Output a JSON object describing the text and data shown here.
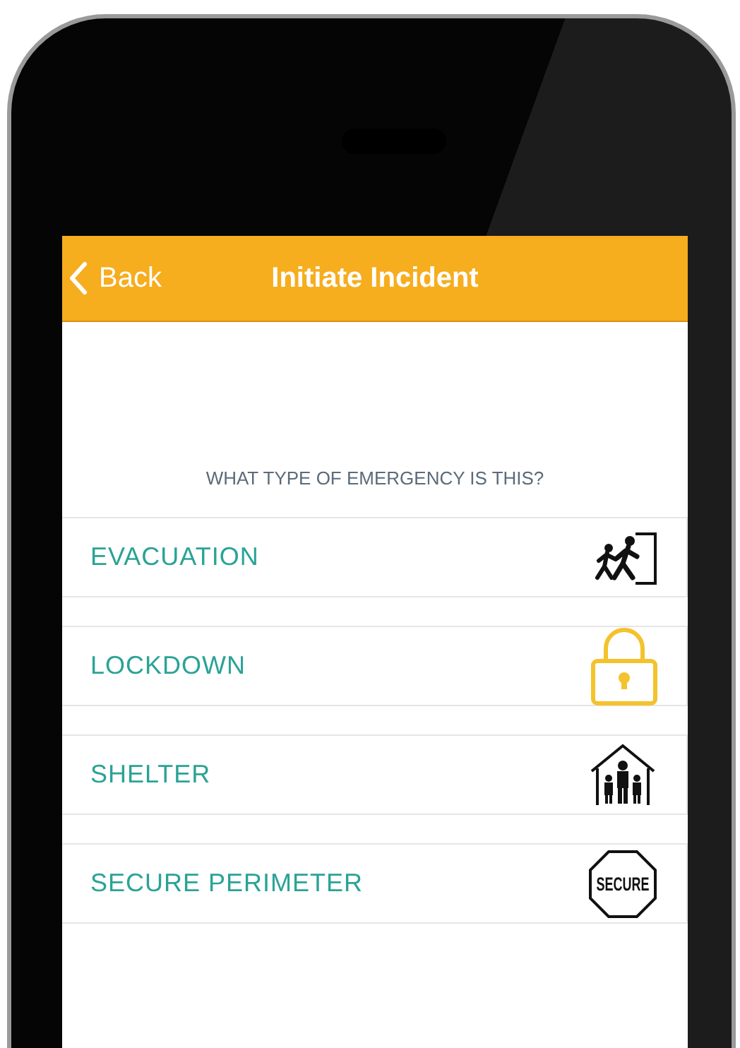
{
  "nav_bar": {
    "back_label": "Back",
    "title": "Initiate Incident"
  },
  "prompt": "WHAT TYPE OF EMERGENCY IS THIS?",
  "options": [
    {
      "label": "EVACUATION",
      "kind": "evacuation"
    },
    {
      "label": "LOCKDOWN",
      "kind": "lockdown"
    },
    {
      "label": "SHELTER",
      "kind": "shelter"
    },
    {
      "label": "SECURE PERIMETER",
      "kind": "secure",
      "icon_text": "SECURE"
    }
  ]
}
